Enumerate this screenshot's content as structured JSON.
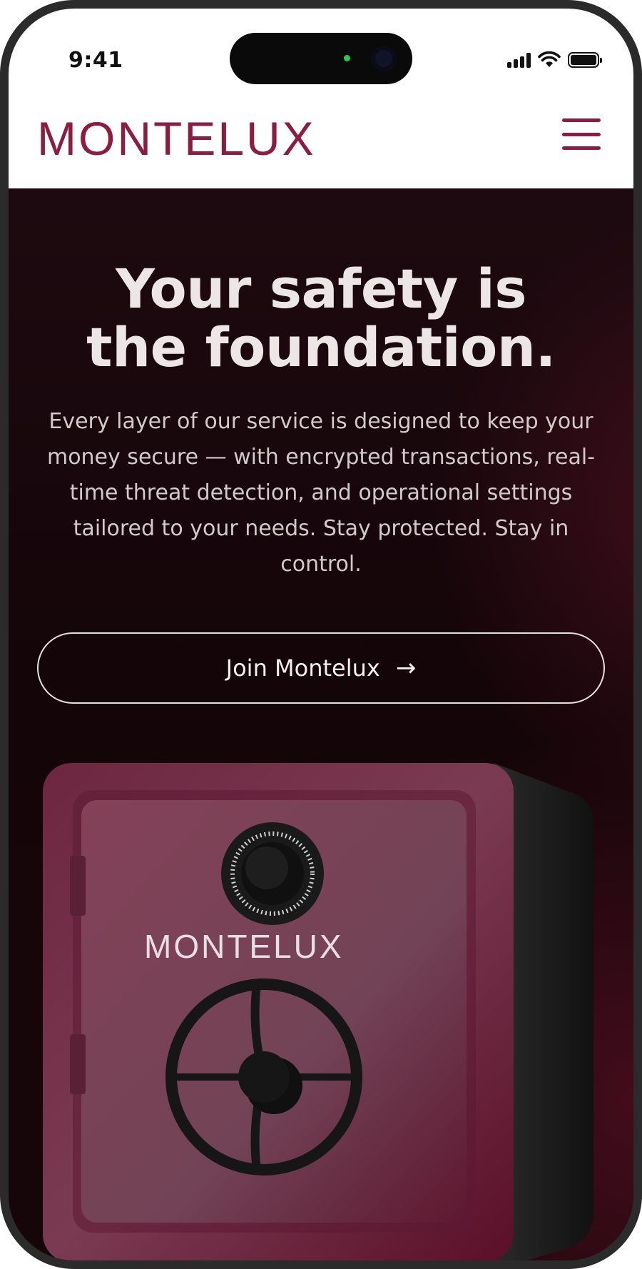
{
  "status_bar": {
    "time": "9:41"
  },
  "header": {
    "brand": "MONTELUX"
  },
  "hero": {
    "headline_line1": "Your safety is",
    "headline_line2": "the foundation.",
    "subtitle": "Every layer of our service is designed to keep your money secure — with encrypted transactions, real-time threat detection, and operational settings tailored to your needs. Stay protected. Stay in control.",
    "cta_label": "Join Montelux",
    "cta_arrow": "→"
  },
  "illustration": {
    "safe_brand": "MONTELUX"
  },
  "colors": {
    "brand": "#8c1d40",
    "hero_bg": "#140509",
    "safe_body": "#7a2a45",
    "text_light": "#ece6e7"
  }
}
